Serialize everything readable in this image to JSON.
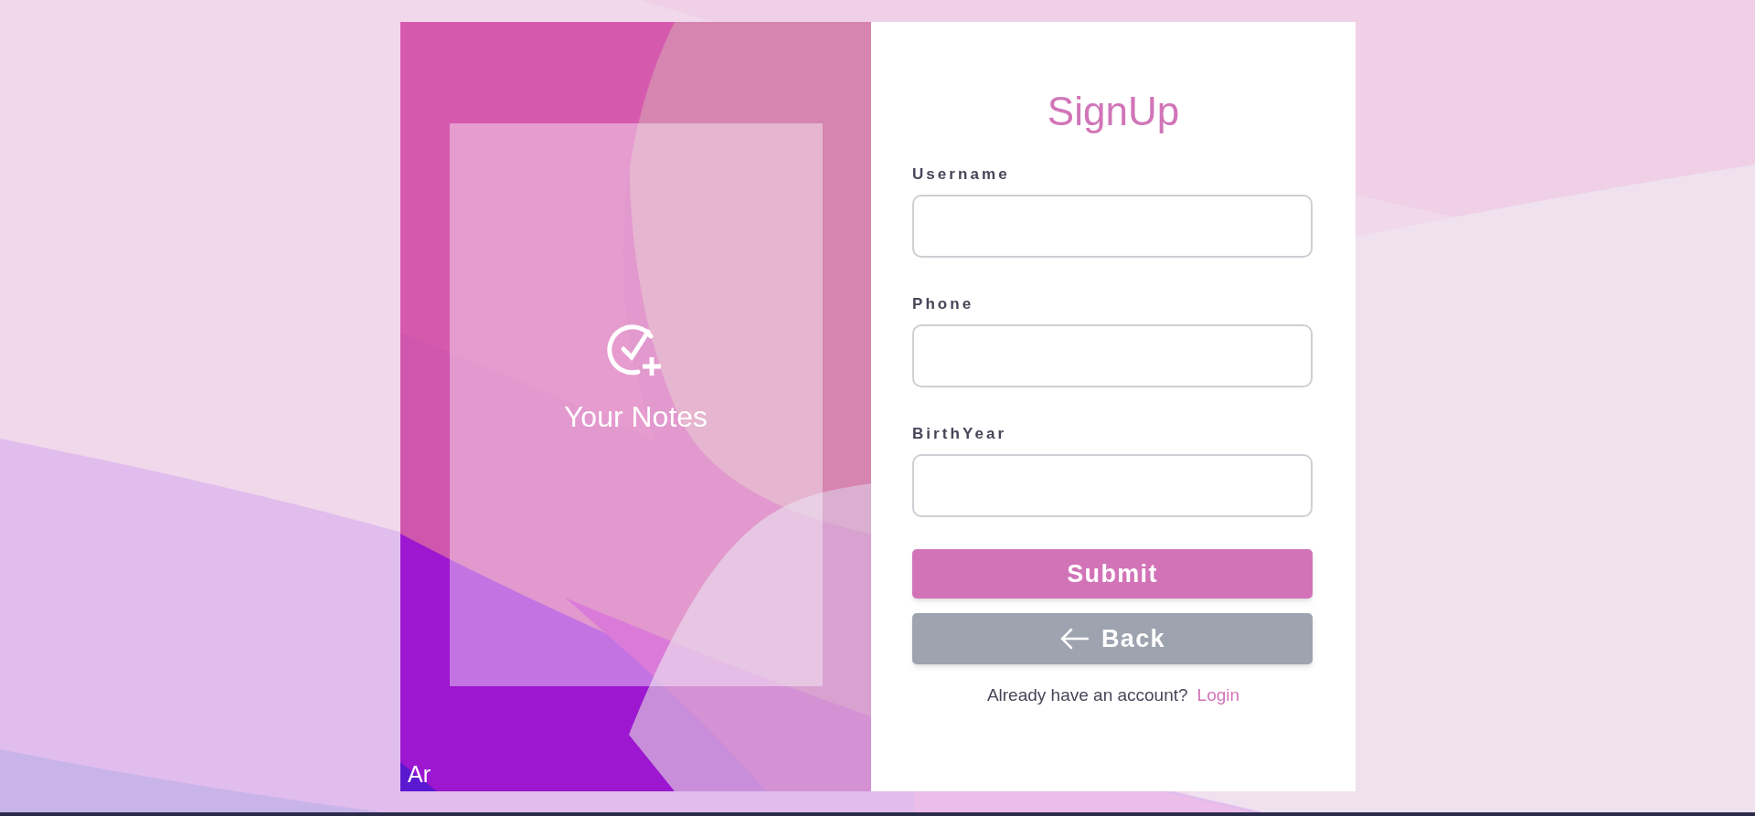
{
  "brand_panel": {
    "title": "Your Notes",
    "language_toggle": "Ar"
  },
  "form": {
    "title": "SignUp",
    "fields": [
      {
        "label": "Username"
      },
      {
        "label": "Phone"
      },
      {
        "label": "BirthYear"
      }
    ],
    "buttons": [
      {
        "kind": "submit",
        "label": "Submit"
      },
      {
        "kind": "back",
        "label": "Back"
      }
    ],
    "footer": {
      "prompt": "Already have an account?",
      "link": "Login"
    }
  }
}
